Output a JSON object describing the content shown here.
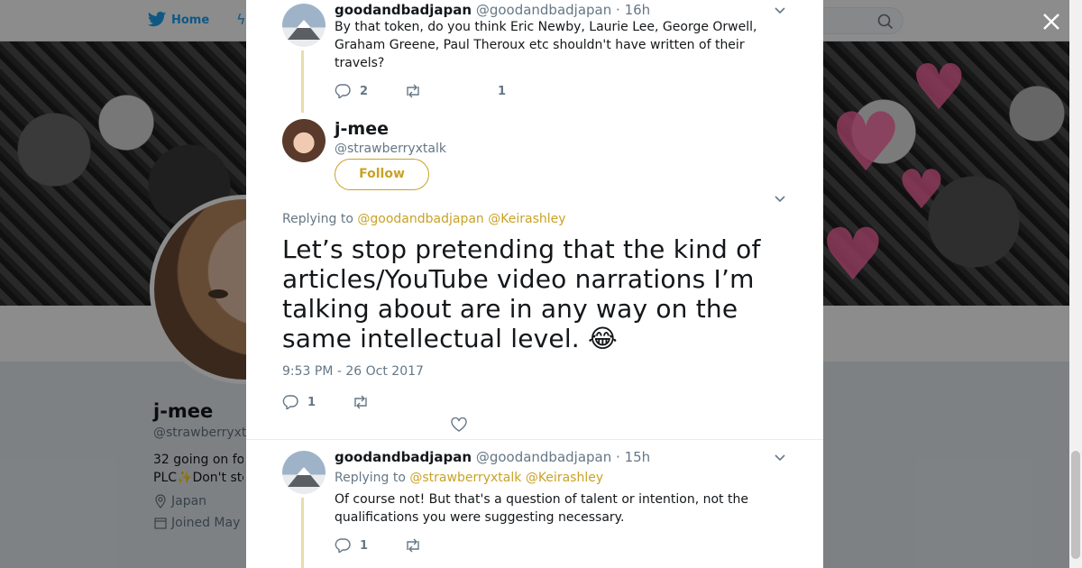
{
  "nav": {
    "home_label": "Home"
  },
  "profile": {
    "name": "j-mee",
    "handle": "@strawberryxtalk",
    "bio_line1": "32 going on fo",
    "bio_line2": "PLC✨Don't sto",
    "location": "Japan",
    "joined": "Joined May"
  },
  "tweets": [
    {
      "name": "goodandbadjapan",
      "handle": "@goodandbadjapan",
      "time": "· 16h",
      "text": "By that token, do you think Eric Newby, Laurie Lee, George Orwell, Graham Greene, Paul Theroux etc shouldn't have written of their travels?",
      "replies": "2",
      "likes": "1"
    },
    {
      "name": "goodandbadjapan",
      "handle": "@goodandbadjapan",
      "time": "· 15h",
      "replying_prefix": "Replying to",
      "replying_to": [
        "@strawberryxtalk",
        "@Keirashley"
      ],
      "text": "Of course not! But that's a question of talent or intention, not the qualifications you were suggesting necessary.",
      "replies": "1"
    }
  ],
  "focus_tweet": {
    "name": "j-mee",
    "handle": "@strawberryxtalk",
    "follow_label": "Follow",
    "replying_prefix": "Replying to",
    "replying_to": [
      "@goodandbadjapan",
      "@Keirashley"
    ],
    "text": "Let’s stop pretending that the kind of articles/YouTube video narrations I’m talking about are in any way on the same intellectual level. 😂",
    "timestamp": "9:53 PM - 26 Oct 2017",
    "replies": "1"
  },
  "colors": {
    "accent": "#c9a227",
    "twitter_blue": "#1da1f2",
    "muted": "#657786"
  },
  "icons": [
    "twitter-bird-icon",
    "lightning-icon",
    "search-icon",
    "close-icon",
    "reply-icon",
    "retweet-icon",
    "heart-icon",
    "chevron-down-icon",
    "location-icon",
    "calendar-icon"
  ]
}
